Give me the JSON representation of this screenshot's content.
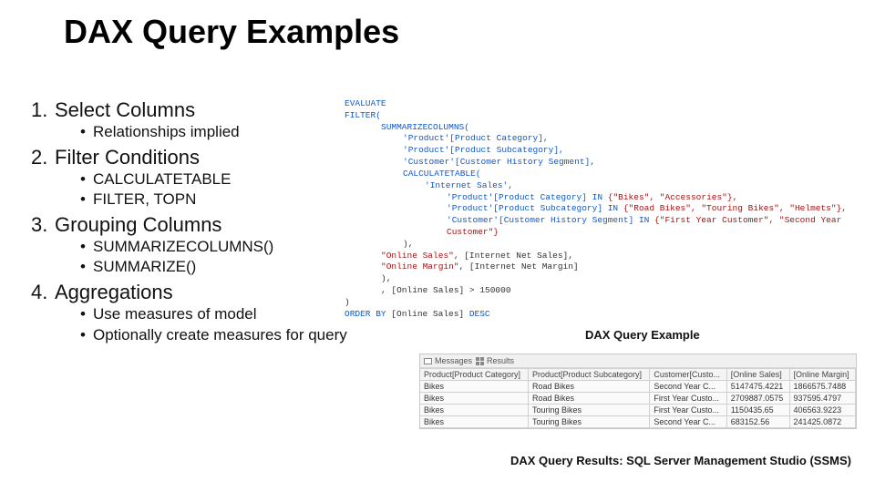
{
  "title": "DAX Query Examples",
  "outline": [
    {
      "num": "1.",
      "title": "Select Columns",
      "bullets": [
        "Relationships implied"
      ]
    },
    {
      "num": "2.",
      "title": "Filter Conditions",
      "bullets": [
        "CALCULATETABLE",
        "FILTER, TOPN"
      ]
    },
    {
      "num": "3.",
      "title": "Grouping Columns",
      "bullets": [
        "SUMMARIZECOLUMNS()",
        "SUMMARIZE()"
      ]
    },
    {
      "num": "4.",
      "title": "Aggregations",
      "bullets": [
        "Use measures of model",
        "Optionally create measures for query"
      ]
    }
  ],
  "code": {
    "l1": "EVALUATE",
    "l2": "FILTER(",
    "l3_fn": "SUMMARIZECOLUMNS(",
    "l4": "'Product'[Product Category],",
    "l5": "'Product'[Product Subcategory],",
    "l6": "'Customer'[Customer History Segment],",
    "l7_fn": "CALCULATETABLE(",
    "l8": "'Internet Sales',",
    "l9_a": "'Product'[Product Category] ",
    "l9_b": "IN",
    "l9_c": " {\"Bikes\", \"Accessories\"},",
    "l10_a": "'Product'[Product Subcategory] ",
    "l10_b": "IN",
    "l10_c": " {\"Road Bikes\", \"Touring Bikes\", \"Helmets\"},",
    "l11_a": "'Customer'[Customer History Segment] ",
    "l11_b": "IN",
    "l11_c": " {\"First Year Customer\", \"Second Year Customer\"}",
    "l12": "),",
    "l13_a": "\"Online Sales\"",
    "l13_b": ", [Internet Net Sales],",
    "l14_a": "\"Online Margin\"",
    "l14_b": ", [Internet Net Margin]",
    "l15": "),",
    "l16": ", [Online Sales] > 150000",
    "l17": ")",
    "l18_a": "ORDER BY",
    "l18_b": " [Online Sales] ",
    "l18_c": "DESC"
  },
  "caption1": "DAX Query Example",
  "caption2": "DAX Query Results: SQL Server Management Studio (SSMS)",
  "results": {
    "tabs": {
      "messages": "Messages",
      "results": "Results"
    },
    "headers": [
      "Product[Product Category]",
      "Product[Product Subcategory]",
      "Customer[Custo...",
      "[Online Sales]",
      "[Online Margin]"
    ],
    "rows": [
      [
        "Bikes",
        "Road Bikes",
        "Second Year C...",
        "5147475.4221",
        "1866575.7488"
      ],
      [
        "Bikes",
        "Road Bikes",
        "First Year Custo...",
        "2709887.0575",
        "937595.4797"
      ],
      [
        "Bikes",
        "Touring Bikes",
        "First Year Custo...",
        "1150435.65",
        "406563.9223"
      ],
      [
        "Bikes",
        "Touring Bikes",
        "Second Year C...",
        "683152.56",
        "241425.0872"
      ]
    ]
  }
}
